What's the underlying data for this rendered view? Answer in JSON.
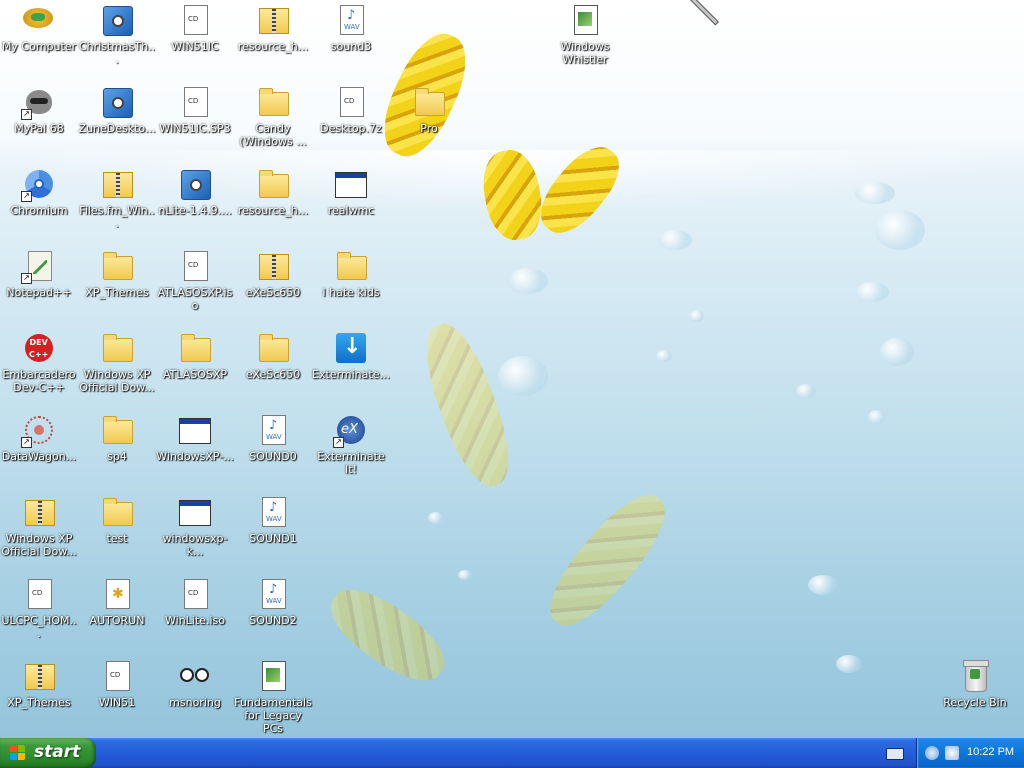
{
  "desktop": {
    "icons": [
      {
        "label": "My Computer",
        "icon": "computer-icon"
      },
      {
        "label": "ChristmasTh...",
        "icon": "setup-icon"
      },
      {
        "label": "WIN51IC",
        "icon": "document-icon"
      },
      {
        "label": "resource_h...",
        "icon": "zip-folder-icon"
      },
      {
        "label": "sound3",
        "icon": "wav-icon"
      },
      {
        "label": "Windows Whistler",
        "icon": "book-icon"
      },
      {
        "label": "MyPal 68",
        "icon": "raccoon-icon"
      },
      {
        "label": "ZuneDeskto...",
        "icon": "setup-icon"
      },
      {
        "label": "WIN51IC.SP3",
        "icon": "document-icon"
      },
      {
        "label": "Candy (Windows ...",
        "icon": "folder-icon"
      },
      {
        "label": "Desktop.7z",
        "icon": "document-icon"
      },
      {
        "label": "Pro",
        "icon": "folder-icon"
      },
      {
        "label": "Chromium",
        "icon": "chromium-icon"
      },
      {
        "label": "Files.fm_Win...",
        "icon": "zip-folder-icon"
      },
      {
        "label": "nLite-1.4.9....",
        "icon": "setup-icon"
      },
      {
        "label": "resource_h...",
        "icon": "folder-icon"
      },
      {
        "label": "realwmc",
        "icon": "window-icon"
      },
      {
        "label": "Notepad++",
        "icon": "notepad-icon"
      },
      {
        "label": "XP_Themes",
        "icon": "folder-icon"
      },
      {
        "label": "ATLASOSXP.iso",
        "icon": "document-icon"
      },
      {
        "label": "eXeSc650",
        "icon": "zip-folder-icon"
      },
      {
        "label": "I hate kids",
        "icon": "folder-icon"
      },
      {
        "label": "Embarcadero Dev-C++",
        "icon": "devcpp-icon"
      },
      {
        "label": "Windows XP Official Dow...",
        "icon": "folder-icon"
      },
      {
        "label": "ATLASOSXP",
        "icon": "folder-icon"
      },
      {
        "label": "eXeSc650",
        "icon": "folder-icon"
      },
      {
        "label": "Exterminate...",
        "icon": "download-icon"
      },
      {
        "label": "DataWagon...",
        "icon": "molecule-icon"
      },
      {
        "label": "sp4",
        "icon": "folder-icon"
      },
      {
        "label": "WindowsXP-...",
        "icon": "window-icon"
      },
      {
        "label": "SOUND0",
        "icon": "wav-icon"
      },
      {
        "label": "Exterminate It!",
        "icon": "exterminate-icon"
      },
      {
        "label": "Windows XP Official Dow...",
        "icon": "zip-folder-icon"
      },
      {
        "label": "test",
        "icon": "folder-icon"
      },
      {
        "label": "windowsxp-k...",
        "icon": "window-icon"
      },
      {
        "label": "SOUND1",
        "icon": "wav-icon"
      },
      {
        "label": "ULCPC_HOM...",
        "icon": "document-icon"
      },
      {
        "label": "AUTORUN",
        "icon": "autorun-icon"
      },
      {
        "label": "WinLite.iso",
        "icon": "document-icon"
      },
      {
        "label": "SOUND2",
        "icon": "wav-icon"
      },
      {
        "label": "XP_Themes",
        "icon": "zip-folder-icon"
      },
      {
        "label": "WIN51",
        "icon": "document-icon"
      },
      {
        "label": "msnoring",
        "icon": "eyes-icon"
      },
      {
        "label": "Fundamentals for Legacy PCs",
        "icon": "book-icon"
      },
      {
        "label": "Recycle Bin",
        "icon": "recycle-bin-icon"
      }
    ]
  },
  "taskbar": {
    "start_label": "start",
    "clock": "10:22 PM"
  },
  "colors": {
    "taskbar_blue": "#245edb",
    "start_green": "#3b9a3b",
    "tray_blue": "#0f75da"
  }
}
